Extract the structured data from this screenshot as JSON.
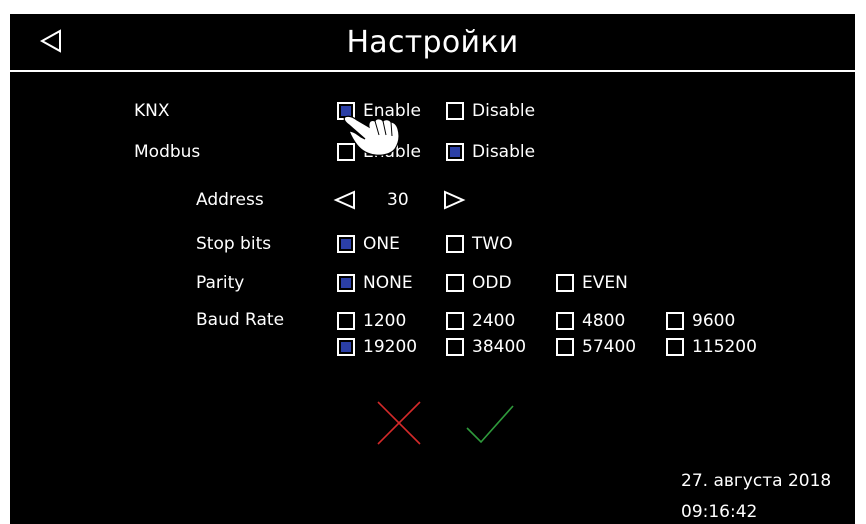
{
  "header": {
    "back_icon": "back-triangle-icon",
    "title": "Настройки"
  },
  "knx": {
    "label": "KNX",
    "enable_label": "Enable",
    "enable_checked": true,
    "disable_label": "Disable",
    "disable_checked": false
  },
  "modbus": {
    "label": "Modbus",
    "enable_label": "Enable",
    "enable_checked": false,
    "disable_label": "Disable",
    "disable_checked": true,
    "address": {
      "label": "Address",
      "value": "30",
      "decrement_icon": "left-triangle-icon",
      "increment_icon": "right-triangle-icon"
    },
    "stop_bits": {
      "label": "Stop bits",
      "options": [
        {
          "label": "ONE",
          "checked": true
        },
        {
          "label": "TWO",
          "checked": false
        }
      ]
    },
    "parity": {
      "label": "Parity",
      "options": [
        {
          "label": "NONE",
          "checked": true
        },
        {
          "label": "ODD",
          "checked": false
        },
        {
          "label": "EVEN",
          "checked": false
        }
      ]
    },
    "baud_rate": {
      "label": "Baud Rate",
      "options": [
        {
          "label": "1200",
          "checked": false
        },
        {
          "label": "2400",
          "checked": false
        },
        {
          "label": "4800",
          "checked": false
        },
        {
          "label": "9600",
          "checked": false
        },
        {
          "label": "19200",
          "checked": true
        },
        {
          "label": "38400",
          "checked": false
        },
        {
          "label": "57400",
          "checked": false
        },
        {
          "label": "115200",
          "checked": false
        }
      ]
    }
  },
  "actions": {
    "cancel_icon": "cross-icon",
    "cancel_color": "#d42a2a",
    "confirm_icon": "checkmark-icon",
    "confirm_color": "#2f9a3c"
  },
  "status": {
    "date": "27. августа 2018",
    "time": "09:16:42"
  },
  "colors": {
    "background": "#000000",
    "foreground": "#ffffff",
    "checked_fill": "#2b3fa6"
  },
  "overlay": {
    "pointer_icon": "hand-pointer-icon"
  }
}
